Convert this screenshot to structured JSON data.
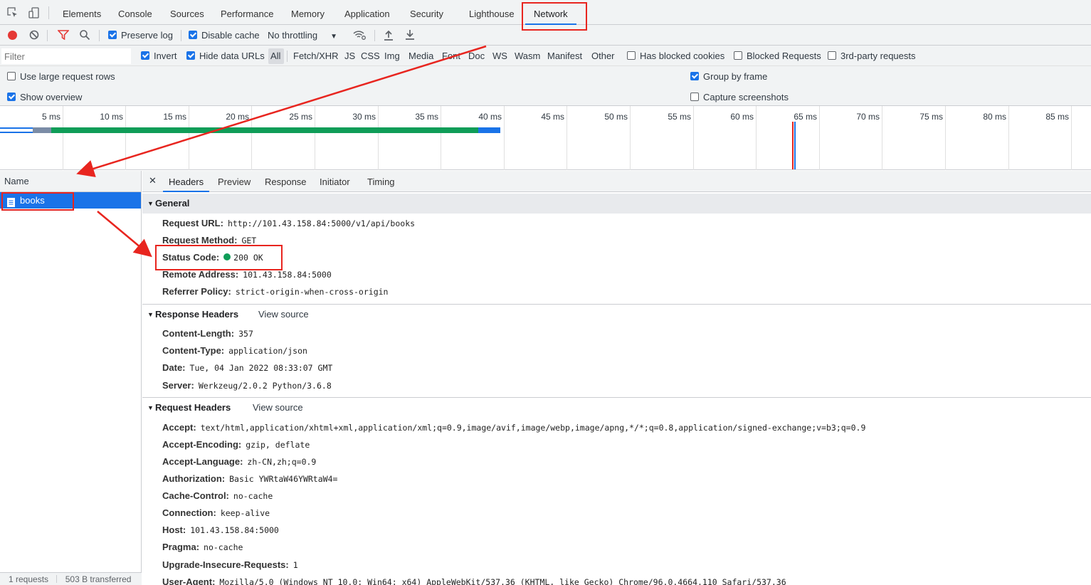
{
  "tabs": [
    "Elements",
    "Console",
    "Sources",
    "Performance",
    "Memory",
    "Application",
    "Security",
    "Lighthouse",
    "Network"
  ],
  "toolbar": {
    "preserve_log": "Preserve log",
    "disable_cache": "Disable cache",
    "throttling": "No throttling"
  },
  "filter": {
    "placeholder": "Filter",
    "invert": "Invert",
    "hide_data_urls": "Hide data URLs",
    "types": [
      "All",
      "Fetch/XHR",
      "JS",
      "CSS",
      "Img",
      "Media",
      "Font",
      "Doc",
      "WS",
      "Wasm",
      "Manifest",
      "Other"
    ],
    "blocked_cookies": "Has blocked cookies",
    "blocked_requests": "Blocked Requests",
    "third_party": "3rd-party requests"
  },
  "options": {
    "large_rows": "Use large request rows",
    "show_overview": "Show overview",
    "group_by_frame": "Group by frame",
    "capture_screenshots": "Capture screenshots"
  },
  "timeline": {
    "ticks": [
      "5 ms",
      "10 ms",
      "15 ms",
      "20 ms",
      "25 ms",
      "30 ms",
      "35 ms",
      "40 ms",
      "45 ms",
      "50 ms",
      "55 ms",
      "60 ms",
      "65 ms",
      "70 ms",
      "75 ms",
      "80 ms",
      "85 ms"
    ]
  },
  "requests": {
    "header": "Name",
    "items": [
      {
        "name": "books"
      }
    ]
  },
  "status_bar": {
    "requests": "1 requests",
    "transferred": "503 B transferred"
  },
  "detail_tabs": [
    "Headers",
    "Preview",
    "Response",
    "Initiator",
    "Timing"
  ],
  "general": {
    "title": "General",
    "rows": [
      {
        "k": "Request URL:",
        "v": "http://101.43.158.84:5000/v1/api/books"
      },
      {
        "k": "Request Method:",
        "v": "GET"
      },
      {
        "k": "Status Code:",
        "v": "200 OK"
      },
      {
        "k": "Remote Address:",
        "v": "101.43.158.84:5000"
      },
      {
        "k": "Referrer Policy:",
        "v": "strict-origin-when-cross-origin"
      }
    ]
  },
  "response_headers": {
    "title": "Response Headers",
    "view_source": "View source",
    "rows": [
      {
        "k": "Content-Length:",
        "v": "357"
      },
      {
        "k": "Content-Type:",
        "v": "application/json"
      },
      {
        "k": "Date:",
        "v": "Tue, 04 Jan 2022 08:33:07 GMT"
      },
      {
        "k": "Server:",
        "v": "Werkzeug/2.0.2 Python/3.6.8"
      }
    ]
  },
  "request_headers": {
    "title": "Request Headers",
    "view_source": "View source",
    "rows": [
      {
        "k": "Accept:",
        "v": "text/html,application/xhtml+xml,application/xml;q=0.9,image/avif,image/webp,image/apng,*/*;q=0.8,application/signed-exchange;v=b3;q=0.9"
      },
      {
        "k": "Accept-Encoding:",
        "v": "gzip, deflate"
      },
      {
        "k": "Accept-Language:",
        "v": "zh-CN,zh;q=0.9"
      },
      {
        "k": "Authorization:",
        "v": "Basic YWRtaW46YWRtaW4="
      },
      {
        "k": "Cache-Control:",
        "v": "no-cache"
      },
      {
        "k": "Connection:",
        "v": "keep-alive"
      },
      {
        "k": "Host:",
        "v": "101.43.158.84:5000"
      },
      {
        "k": "Pragma:",
        "v": "no-cache"
      },
      {
        "k": "Upgrade-Insecure-Requests:",
        "v": "1"
      },
      {
        "k": "User-Agent:",
        "v": "Mozilla/5.0 (Windows NT 10.0; Win64; x64) AppleWebKit/537.36 (KHTML, like Gecko) Chrome/96.0.4664.110 Safari/537.36"
      }
    ]
  },
  "colors": {
    "accent": "#1a73e8",
    "record": "#e53935",
    "annotation": "#e8251f",
    "status_ok": "#0f9d58"
  }
}
